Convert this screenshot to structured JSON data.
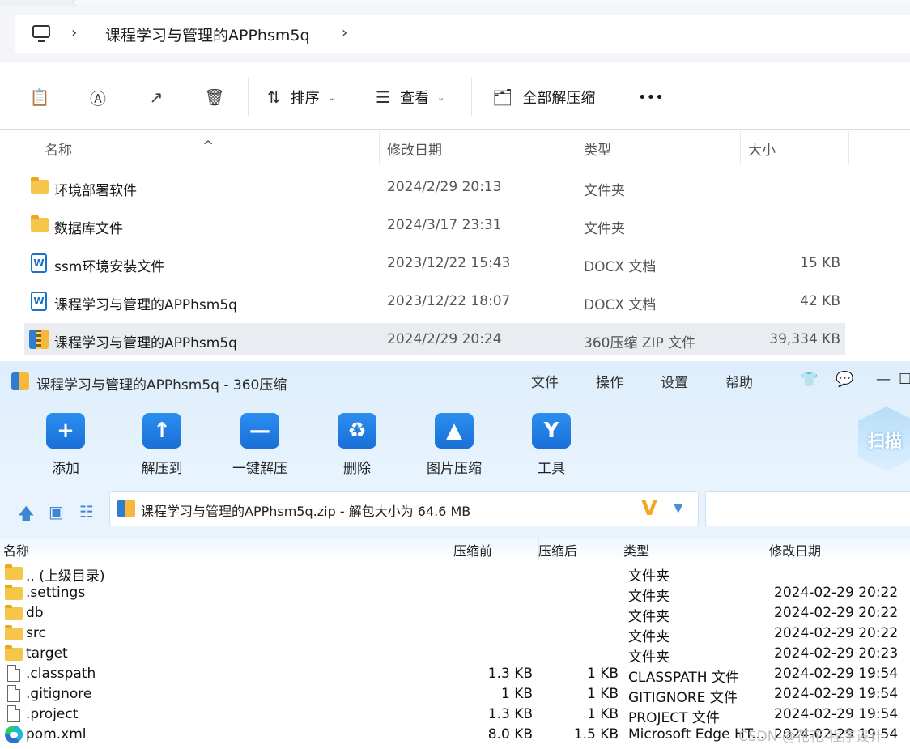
{
  "explorer": {
    "address": "课程学习与管理的APPhsm5q",
    "toolbar": {
      "sort_label": "排序",
      "view_label": "查看",
      "extract_all_label": "全部解压缩",
      "more_label": "•••"
    },
    "columns": {
      "name": "名称",
      "date": "修改日期",
      "type": "类型",
      "size": "大小"
    },
    "files": [
      {
        "icon": "folder-icon",
        "name": "环境部署软件",
        "date": "2024/2/29 20:13",
        "type": "文件夹",
        "size": ""
      },
      {
        "icon": "folder-icon",
        "name": "数据库文件",
        "date": "2024/3/17 23:31",
        "type": "文件夹",
        "size": ""
      },
      {
        "icon": "word-doc-icon",
        "name": "ssm环境安装文件",
        "date": "2023/12/22 15:43",
        "type": "DOCX 文档",
        "size": "15 KB"
      },
      {
        "icon": "word-doc-icon",
        "name": "课程学习与管理的APPhsm5q",
        "date": "2023/12/22 18:07",
        "type": "DOCX 文档",
        "size": "42 KB"
      },
      {
        "icon": "zip-archive-icon",
        "name": "课程学习与管理的APPhsm5q",
        "date": "2024/2/29 20:24",
        "type": "360压缩 ZIP 文件",
        "size": "39,334 KB",
        "selected": true
      }
    ]
  },
  "zip_window": {
    "title": "课程学习与管理的APPhsm5q - 360压缩",
    "menu": [
      "文件",
      "操作",
      "设置",
      "帮助"
    ],
    "window_controls": [
      "—",
      "☐"
    ],
    "tools": [
      {
        "label": "添加",
        "icon": "add-icon",
        "glyph": "+"
      },
      {
        "label": "解压到",
        "icon": "extract-to-icon",
        "glyph": "↑"
      },
      {
        "label": "一键解压",
        "icon": "quick-extract-icon",
        "glyph": "—"
      },
      {
        "label": "删除",
        "icon": "recycle-bin-icon",
        "glyph": "♻"
      },
      {
        "label": "图片压缩",
        "icon": "image-compress-icon",
        "glyph": "▲"
      },
      {
        "label": "工具",
        "icon": "tools-icon",
        "glyph": "Y"
      }
    ],
    "scan_label": "扫描",
    "path": "课程学习与管理的APPhsm5q.zip - 解包大小为 64.6 MB",
    "columns": {
      "name": "名称",
      "before": "压缩前",
      "after": "压缩后",
      "type": "类型",
      "date": "修改日期"
    },
    "rows": [
      {
        "icon": "folder-icon",
        "name": ".. (上级目录)",
        "before": "",
        "after": "",
        "type": "文件夹",
        "date": ""
      },
      {
        "icon": "folder-icon",
        "name": ".settings",
        "before": "",
        "after": "",
        "type": "文件夹",
        "date": "2024-02-29 20:22"
      },
      {
        "icon": "folder-icon",
        "name": "db",
        "before": "",
        "after": "",
        "type": "文件夹",
        "date": "2024-02-29 20:22"
      },
      {
        "icon": "folder-icon",
        "name": "src",
        "before": "",
        "after": "",
        "type": "文件夹",
        "date": "2024-02-29 20:22"
      },
      {
        "icon": "folder-icon",
        "name": "target",
        "before": "",
        "after": "",
        "type": "文件夹",
        "date": "2024-02-29 20:23"
      },
      {
        "icon": "file-icon",
        "name": ".classpath",
        "before": "1.3 KB",
        "after": "1 KB",
        "type": "CLASSPATH 文件",
        "date": "2024-02-29 19:54"
      },
      {
        "icon": "file-icon",
        "name": ".gitignore",
        "before": "1 KB",
        "after": "1 KB",
        "type": "GITIGNORE 文件",
        "date": "2024-02-29 19:54"
      },
      {
        "icon": "file-icon",
        "name": ".project",
        "before": "1.3 KB",
        "after": "1 KB",
        "type": "PROJECT 文件",
        "date": "2024-02-29 19:54"
      },
      {
        "icon": "edge-icon",
        "name": "pom.xml",
        "before": "8.0 KB",
        "after": "1.5 KB",
        "type": "Microsoft Edge HT...",
        "date": "2024-02-29 19:54"
      }
    ]
  },
  "watermark": "CSDN @花花-程序设计"
}
